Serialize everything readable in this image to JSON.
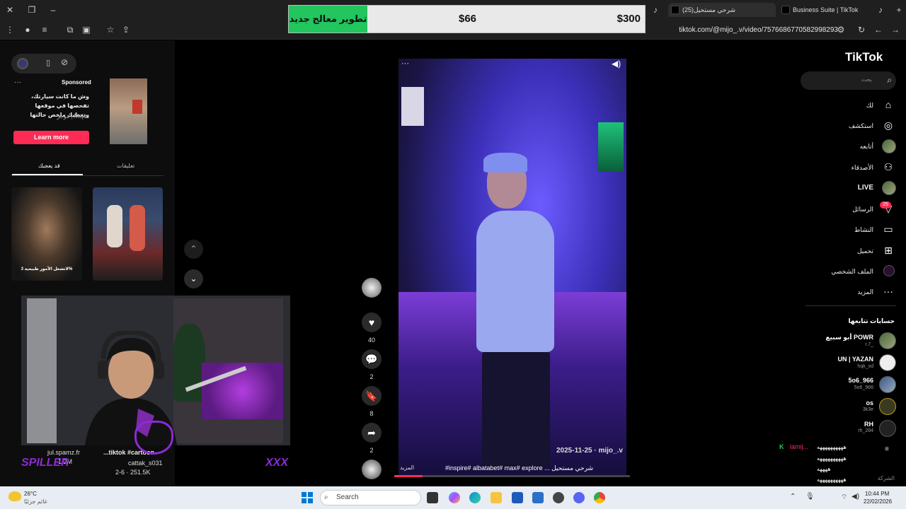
{
  "browser": {
    "tabs": [
      {
        "label": "(25)شرحي مستحيل"
      },
      {
        "label": "Business Suite | TikTok"
      }
    ],
    "url": "tiktok.com/@mijo_.v/video/7576686770582998293"
  },
  "overlay": {
    "green_label": "تطوير معالج جديد",
    "price_mid": "$66",
    "price_right": "$300"
  },
  "ad": {
    "sponsored": "Sponsored",
    "text": "وش ما كانت سيارتك، تفحصها في موقعها وتعطيك ملخص حالتها",
    "source": "Mojaz | موجز",
    "cta": "Learn more"
  },
  "left_tabs": {
    "you_may_like": "قد يعجبك",
    "comments": "تعليقات"
  },
  "thumbs": [
    {
      "caption": "لاتشغل الأمور طبيعية 3%"
    }
  ],
  "stream": {
    "user1": "jul.spamz.fr",
    "user1_likes": "1.2M",
    "user2": "cattak_s031",
    "title2": "...tiktok #cartoon",
    "meta2": "2-6 · 251.5K",
    "left_logo": "SPILLER",
    "right_logo": "XXX"
  },
  "video": {
    "author_date": "2025-11-25 · mijo_.v",
    "caption": "شرحي مستحيل ... inspire# albatabet# max# explore#",
    "more": "المزيد"
  },
  "actions": {
    "likes": "40",
    "comments": "2",
    "saves": "8",
    "shares": "2"
  },
  "sidebar": {
    "logo": "TikTok",
    "search_placeholder": "بحث",
    "nav": [
      {
        "label": "لك",
        "icon": "home-icon"
      },
      {
        "label": "استكشف",
        "icon": "compass-icon"
      },
      {
        "label": "أتابعه",
        "icon": "following-avatar-icon"
      },
      {
        "label": "الأصدقاء",
        "icon": "friends-icon"
      },
      {
        "label": "LIVE",
        "icon": "live-icon"
      },
      {
        "label": "الرسائل",
        "icon": "inbox-icon",
        "badge": "25"
      },
      {
        "label": "النشاط",
        "icon": "activity-icon"
      },
      {
        "label": "تحميل",
        "icon": "upload-icon"
      },
      {
        "label": "الملف الشخصي",
        "icon": "profile-icon"
      },
      {
        "label": "المزيد",
        "icon": "more-icon"
      }
    ],
    "following_title": "حسابات تتابعها",
    "accounts": [
      {
        "name": "أبو سبيع POWR",
        "handle": "r.7_"
      },
      {
        "name": "UN | YAZAN",
        "handle": "hqk_xd"
      },
      {
        "name": "5o6_966",
        "handle": "5o6_966"
      },
      {
        "name": "os",
        "handle": "3k3e"
      },
      {
        "name": "RH",
        "handle": "rh_284"
      }
    ],
    "company": "الشركة"
  },
  "chat": {
    "user": "lamij...",
    "messages": [
      "ههههههههههه",
      "ههههههههههه",
      "ههههه",
      "ههههههههههه"
    ]
  },
  "taskbar": {
    "weather_temp": "26°C",
    "weather_desc": "غائم جزئيًا",
    "search": "Search",
    "time": "10:44 PM",
    "date": "22/02/2026"
  }
}
